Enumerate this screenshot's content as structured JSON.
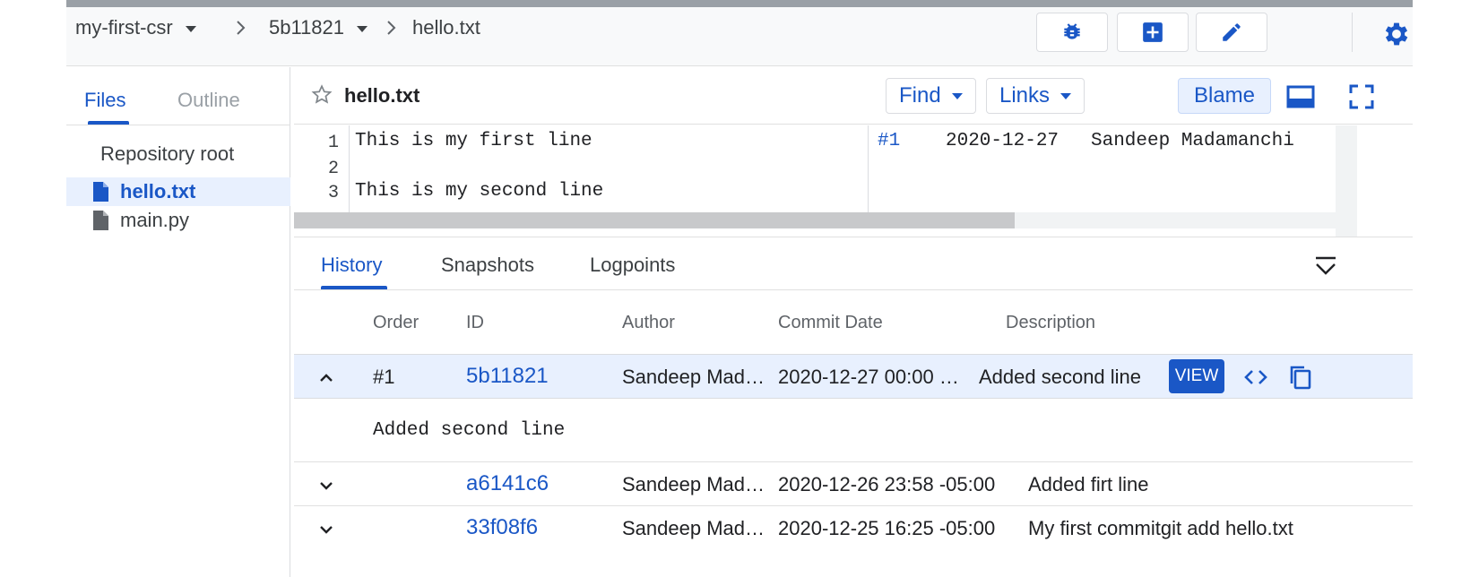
{
  "breadcrumb": {
    "repo": "my-first-csr",
    "commit": "5b11821",
    "file": "hello.txt"
  },
  "header_buttons": [
    "debug-icon",
    "add-box-icon",
    "edit-icon",
    "gear-icon"
  ],
  "sidebar": {
    "tabs": [
      {
        "label": "Files",
        "active": true
      },
      {
        "label": "Outline",
        "active": false
      }
    ],
    "root_label": "Repository root",
    "files": [
      {
        "name": "hello.txt",
        "selected": true
      },
      {
        "name": "main.py",
        "selected": false
      }
    ]
  },
  "editor": {
    "filename": "hello.txt",
    "find_label": "Find",
    "links_label": "Links",
    "blame_label": "Blame",
    "lines": [
      {
        "num": "1",
        "text": "This is my first line"
      },
      {
        "num": "2",
        "text": ""
      },
      {
        "num": "3",
        "text": "This is my second line"
      }
    ],
    "blame": {
      "order": "#1",
      "date": "2020-12-27",
      "author": "Sandeep Madamanchi"
    }
  },
  "panel": {
    "tabs": [
      {
        "label": "History",
        "active": true
      },
      {
        "label": "Snapshots",
        "active": false
      },
      {
        "label": "Logpoints",
        "active": false
      }
    ],
    "columns": {
      "order": "Order",
      "id": "ID",
      "author": "Author",
      "date": "Commit Date",
      "description": "Description"
    },
    "rows": [
      {
        "order": "#1",
        "id": "5b11821",
        "author": "Sandeep Mad…",
        "date": "2020-12-27 00:00 …",
        "description": "Added second line",
        "expanded": true,
        "message": "Added second line",
        "view_label": "VIEW"
      },
      {
        "order": "",
        "id": "a6141c6",
        "author": "Sandeep Mad…",
        "date": "2020-12-26 23:58 -05:00",
        "description": "Added firt line",
        "expanded": false
      },
      {
        "order": "",
        "id": "33f08f6",
        "author": "Sandeep Mad…",
        "date": "2020-12-25 16:25 -05:00",
        "description": "My first commitgit add hello.txt",
        "expanded": false
      }
    ]
  },
  "colors": {
    "accent": "#1a57c6",
    "selected_bg": "#e8f0fe",
    "header_bg": "#f8f9fa"
  }
}
